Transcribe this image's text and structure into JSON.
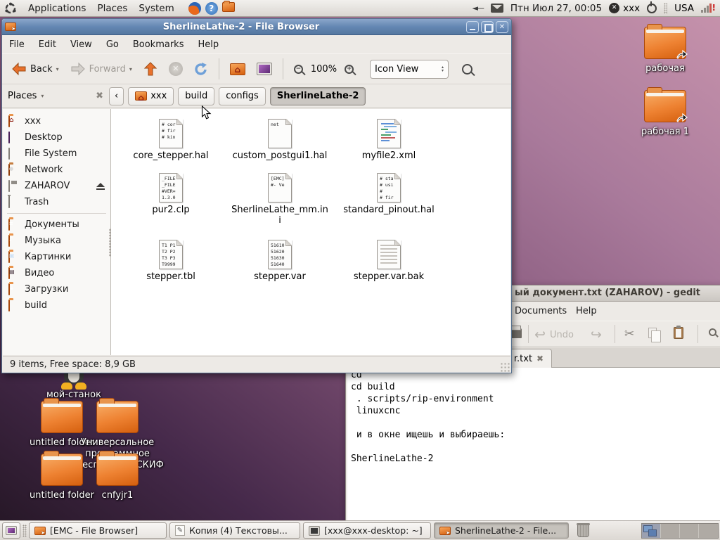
{
  "panel": {
    "menus": [
      {
        "label": "Applications"
      },
      {
        "label": "Places"
      },
      {
        "label": "System"
      }
    ],
    "clock": "Птн Июл 27, 00:05",
    "user_label": "xxx",
    "keyboard_layout": "USA",
    "icons": [
      "distro-logo-icon",
      "firefox-icon",
      "help-icon",
      "file-manager-icon",
      "volume-muted-icon",
      "mail-icon",
      "user-switcher-icon",
      "power-icon",
      "network-signal-icon"
    ]
  },
  "file_browser": {
    "title": "SherlineLathe-2 - File Browser",
    "menu": [
      "File",
      "Edit",
      "View",
      "Go",
      "Bookmarks",
      "Help"
    ],
    "toolbar": {
      "back": "Back",
      "forward": "Forward",
      "zoom_level": "100%",
      "view_mode": "Icon View"
    },
    "places_header": "Places",
    "sidebar": [
      {
        "label": "xxx",
        "icon": "home-folder-icon"
      },
      {
        "label": "Desktop",
        "icon": "desktop-icon"
      },
      {
        "label": "File System",
        "icon": "drive-icon"
      },
      {
        "label": "Network",
        "icon": "network-icon"
      },
      {
        "label": "ZAHAROV",
        "icon": "usb-drive-icon"
      },
      {
        "label": "Trash",
        "icon": "trash-icon"
      },
      {
        "label": "Документы",
        "icon": "documents-folder-icon"
      },
      {
        "label": "Музыка",
        "icon": "music-folder-icon"
      },
      {
        "label": "Картинки",
        "icon": "pictures-folder-icon"
      },
      {
        "label": "Видео",
        "icon": "video-folder-icon"
      },
      {
        "label": "Загрузки",
        "icon": "downloads-folder-icon"
      },
      {
        "label": "build",
        "icon": "folder-icon"
      }
    ],
    "path": [
      {
        "label": "xxx"
      },
      {
        "label": "build"
      },
      {
        "label": "configs"
      },
      {
        "label": "SherlineLathe-2"
      }
    ],
    "files": [
      {
        "name": "core_stepper.hal",
        "preview": [
          "# cor",
          "",
          "# fir",
          "# kin"
        ]
      },
      {
        "name": "custom_postgui1.hal",
        "preview": [
          "",
          "",
          "",
          "net"
        ]
      },
      {
        "name": "myfile2.xml",
        "kind": "xml"
      },
      {
        "name": "pur2.clp",
        "preview": [
          "_FILE",
          "_FILE",
          "#VER=",
          "1.3.0"
        ]
      },
      {
        "name": "SherlineLathe_mm.ini",
        "preview": [
          "[EMC]",
          "",
          "",
          "#- Ve"
        ]
      },
      {
        "name": "standard_pinout.hal",
        "preview": [
          "# sta",
          "# usi",
          "#",
          "# fir"
        ]
      },
      {
        "name": "stepper.tbl",
        "preview": [
          "T1 P1",
          "T2 P2",
          "T3 P3",
          "T9999"
        ]
      },
      {
        "name": "stepper.var",
        "preview": [
          "51610",
          "51620",
          "51630",
          "51640"
        ]
      },
      {
        "name": "stepper.var.bak",
        "kind": "backup"
      }
    ],
    "status": "9 items, Free space: 8,9 GB"
  },
  "gedit": {
    "title": "ый документ.txt (ZAHAROV) - gedit",
    "menu": [
      "Documents",
      "Help"
    ],
    "undo_label": "Undo",
    "tab_label": "r.txt",
    "text": "cd\ncd build\n . scripts/rip-environment\n linuxcnc\n\n и в окне ищешь и выбираешь:\n\nSherlineLathe-2"
  },
  "desktop_icons": [
    {
      "label": "рабочая"
    },
    {
      "label": "рабочая 1"
    },
    {
      "label": "мой-станок"
    },
    {
      "label": "untitled folder"
    },
    {
      "label": "Универсальное программное обеспечение СКИФ"
    },
    {
      "label": "untitled folder"
    },
    {
      "label": "cnfyjr1"
    }
  ],
  "taskbar": {
    "windows": [
      {
        "label": "[EMC - File Browser]"
      },
      {
        "label": "Копия (4) Текстовы..."
      },
      {
        "label": "[xxx@xxx-desktop: ~]"
      },
      {
        "label": "SherlineLathe-2 - File..."
      }
    ]
  },
  "colors": {
    "titlebar_active": "#54779F",
    "folder_orange": "#EE8232",
    "desktop_top_right": "#C793AC",
    "desktop_bottom_left": "#241624"
  }
}
